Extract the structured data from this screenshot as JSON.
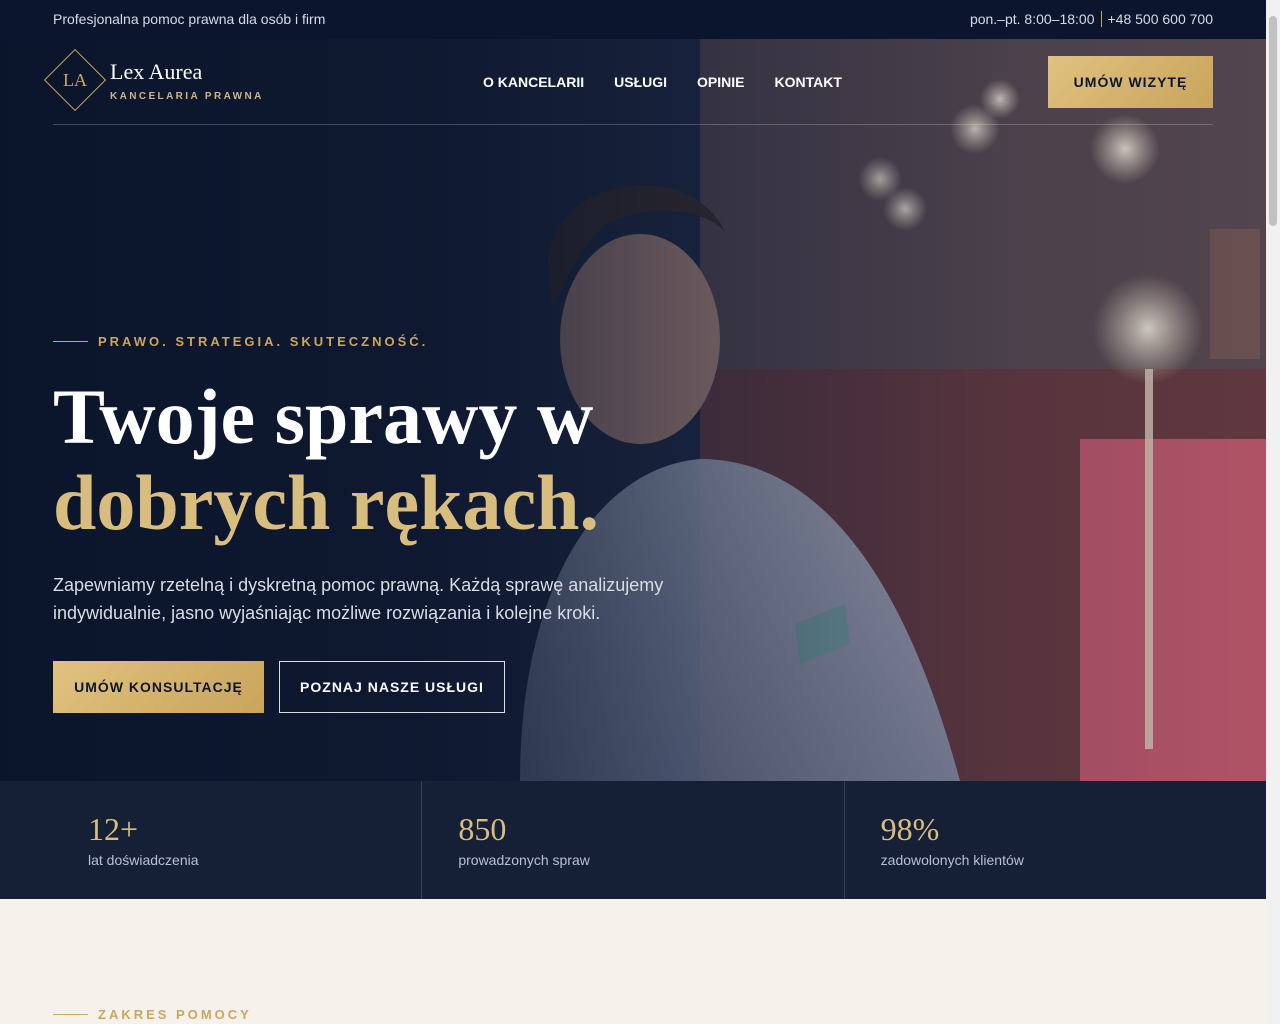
{
  "topbar": {
    "left_text": "Profesjonalna pomoc prawna dla osób i firm",
    "hours": "pon.–pt. 8:00–18:00",
    "phone": "+48 500 600 700"
  },
  "logo": {
    "mark": "LA",
    "name": "Lex Aurea",
    "subtitle": "KANCELARIA PRAWNA"
  },
  "nav": {
    "items": [
      "O KANCELARII",
      "USŁUGI",
      "OPINIE",
      "KONTAKT"
    ],
    "cta": "UMÓW WIZYTĘ"
  },
  "hero": {
    "tagline": "PRAWO. STRATEGIA. SKUTECZNOŚĆ.",
    "title_line1": "Twoje sprawy w",
    "title_line2": "dobrych rękach.",
    "lead": "Zapewniamy rzetelną i dyskretną pomoc prawną. Każdą sprawę analizujemy indywidualnie, jasno wyjaśniając możliwe rozwiązania i kolejne kroki.",
    "primary_button": "UMÓW KONSULTACJĘ",
    "secondary_button": "POZNAJ NASZE USŁUGI"
  },
  "stats": [
    {
      "value": "12+",
      "label": "lat doświadczenia"
    },
    {
      "value": "850",
      "label": "prowadzonych spraw"
    },
    {
      "value": "98%",
      "label": "zadowolonych klientów"
    }
  ],
  "section2": {
    "tagline": "ZAKRES POMOCY"
  },
  "colors": {
    "navy": "#0b162e",
    "gold": "#c9a75e",
    "gold_light": "#d9bd7e",
    "cream": "#f6f1ea"
  }
}
